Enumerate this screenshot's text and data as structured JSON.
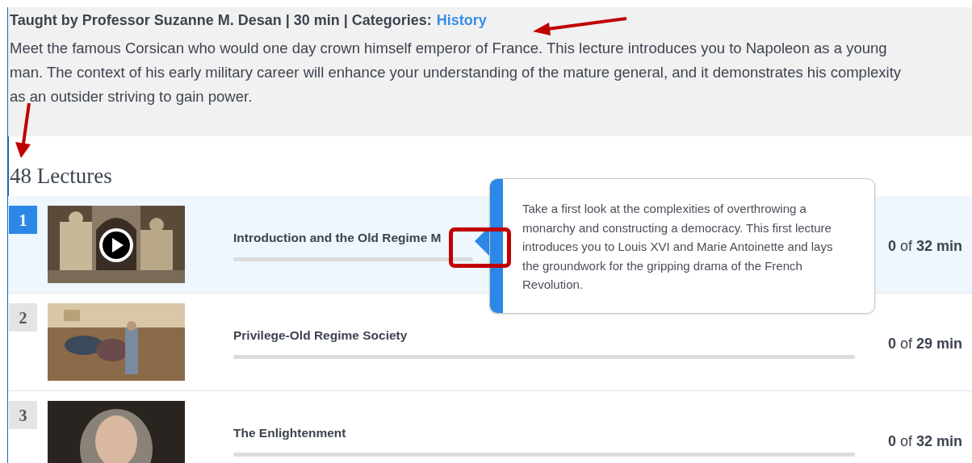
{
  "course": {
    "meta": "Taught by Professor Suzanne M. Desan | 30 min | Categories:",
    "category_link": "History",
    "description": "Meet the famous Corsican who would one day crown himself emperor of France. This lecture introduces you to Napoleon as a young man. The context of his early military career will enhance your understanding of the mature general, and it demonstrates his complexity as an outsider striving to gain power."
  },
  "lectures_heading": "48 Lectures",
  "lectures": [
    {
      "number": "1",
      "title": "Introduction and the Old Regime M",
      "selected": true,
      "level": 0,
      "duration": "**0** of **32 min**"
    },
    {
      "number": "2",
      "title": "Privilege-Old Regime Society",
      "selected": false,
      "level": 0,
      "duration": "**0** of **29 min**"
    },
    {
      "number": "3",
      "title": "The Enlightenment",
      "selected": false,
      "level": 0,
      "duration": "**0** of **32 min**"
    }
  ],
  "tooltip": {
    "text": "Take a first look at the complexities of overthrowing a monarchy and constructing a democracy. This first lecture introduces you to Louis XVI and Marie Antoinette and lays the groundwork for the gripping drama of the French Revolution."
  },
  "annotations": [
    {
      "kind": "arrow"
    },
    {
      "kind": "arrow"
    },
    {
      "kind": "frame"
    }
  ]
}
